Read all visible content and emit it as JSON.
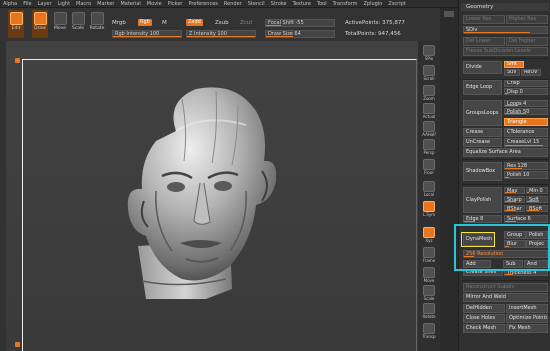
{
  "menu": [
    "Alpha",
    "File",
    "Layer",
    "Light",
    "Macro",
    "Marker",
    "Material",
    "Movie",
    "Picker",
    "Preferences",
    "Render",
    "Stencil",
    "Stroke",
    "Texture",
    "Tool",
    "Transform",
    "Zplugin",
    "Zscript"
  ],
  "toolbar": {
    "edit": "Edit",
    "draw": "Draw",
    "move": "Move",
    "scale": "Scale",
    "rotate": "Rotate",
    "mrgb": "Mrgb",
    "rgb": "Rgb",
    "m": "M",
    "zadd": "Zadd",
    "zsub": "Zsub",
    "zcut": "Zcut",
    "rgb_intensity": "Rgb Intensity 100",
    "z_intensity": "Z Intensity 100",
    "focal_shift": "Focal Shift -55",
    "draw_size": "Draw Size 64",
    "active_points": "ActivePoints: 375,877",
    "total_points": "TotalPoints: 947,456"
  },
  "canvas": {
    "brand": "ZBrush"
  },
  "right_shelf": [
    {
      "label": "SPix",
      "icon": "spix-icon"
    },
    {
      "label": "Scroll",
      "icon": "scroll-icon"
    },
    {
      "label": "Zoom",
      "icon": "zoom-icon"
    },
    {
      "label": "Actual",
      "icon": "actual-icon"
    },
    {
      "label": "AAHalf",
      "icon": "aahalf-icon"
    },
    {
      "label": "Persp",
      "icon": "persp-icon"
    },
    {
      "label": "Floor",
      "icon": "floor-icon"
    },
    {
      "label": "Local",
      "icon": "local-icon"
    },
    {
      "label": "L.Sym",
      "icon": "lsym-icon"
    },
    {
      "label": "Xyz",
      "icon": "xyz-icon"
    },
    {
      "label": "Frame",
      "icon": "frame-icon"
    },
    {
      "label": "Move",
      "icon": "move-icon"
    },
    {
      "label": "Scale",
      "icon": "scale-icon"
    },
    {
      "label": "Rotate",
      "icon": "rotate-icon"
    },
    {
      "label": "Transp",
      "icon": "transp-icon"
    }
  ],
  "palette": {
    "title": "Geometry",
    "lower_res": "Lower Res",
    "higher_res": "Higher Res",
    "sdiv": "SDiv",
    "del_lower": "Del Lower",
    "del_higher": "Del Higher",
    "freeze": "Freeze SubDivision Levels",
    "divide": "Divide",
    "smt": "Smt",
    "suv": "Suv",
    "reuv": "ReUV",
    "edge_loop": "Edge Loop",
    "crisp": "Crisp",
    "disp": "Disp 0",
    "grouploops": "GroupsLoops",
    "loops": "Loops 4",
    "polish_val": "Polish 50",
    "triangle": "Triangle",
    "crease": "Crease",
    "ctolerance": "CTolerance",
    "uncrease": "UnCrease",
    "creaselvl": "CreaseLvl 15",
    "equalize": "Equalize Surface Area",
    "shadowbox": "ShadowBox",
    "res": "Res 128",
    "polish10": "Polish 10",
    "claypolish": "ClayPolish",
    "max": "Max",
    "min": "Min 0",
    "sharp": "Sharp",
    "soft": "Soft",
    "bshar": "BShar",
    "bsoft": "BSoft",
    "edge": "Edge 8",
    "surface": "Surface 6",
    "dynamesh": "DynaMesh",
    "group": "Group",
    "polish": "Polish",
    "blur": "Blur",
    "project": "Projec",
    "resolution": "256 Resolution",
    "add": "Add",
    "sub": "Sub",
    "and": "And",
    "create_shell": "Create Shell",
    "thickness": "Thickness 4",
    "reconstruct": "Reconstruct Subdiv",
    "mirror_weld": "Mirror And Weld",
    "deladden": "DelHidden",
    "insertmesh": "InsertMesh",
    "close_holes": "Close Holes",
    "optimize": "Optimize Points",
    "check_mesh": "Check Mesh",
    "fix_mesh": "Fix Mesh"
  }
}
